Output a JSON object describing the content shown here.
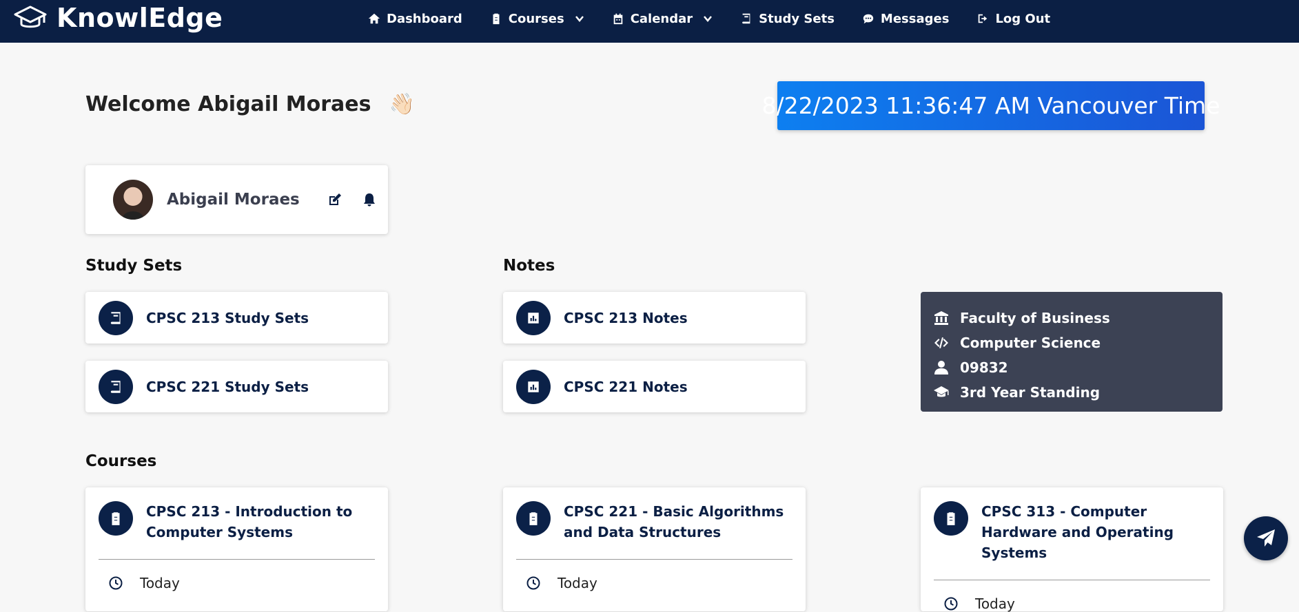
{
  "brand": {
    "name": "KnowlEdge"
  },
  "nav": {
    "dashboard": "Dashboard",
    "courses": "Courses",
    "calendar": "Calendar",
    "study_sets": "Study Sets",
    "messages": "Messages",
    "logout": "Log Out"
  },
  "welcome": {
    "text": "Welcome Abigail Moraes",
    "emoji": "👋🏻"
  },
  "clock": {
    "text": "8/22/2023 11:36:47 AM Vancouver Time"
  },
  "profile": {
    "name": "Abigail Moraes"
  },
  "study_sets": {
    "title": "Study Sets",
    "items": [
      {
        "label": "CPSC 213 Study Sets"
      },
      {
        "label": "CPSC 221 Study Sets"
      }
    ]
  },
  "notes": {
    "title": "Notes",
    "items": [
      {
        "label": "CPSC 213 Notes"
      },
      {
        "label": "CPSC 221 Notes"
      }
    ]
  },
  "info": {
    "faculty": "Faculty of Business",
    "program": "Computer Science",
    "student_id": "09832",
    "standing": "3rd Year Standing"
  },
  "courses": {
    "title": "Courses",
    "items": [
      {
        "title": "CPSC 213 - Introduction to Computer Systems",
        "when": "Today"
      },
      {
        "title": "CPSC 221 - Basic Algorithms and Data Structures",
        "when": "Today"
      },
      {
        "title": "CPSC 313 - Computer Hardware and Operating Systems",
        "when": "Today"
      }
    ]
  },
  "colors": {
    "navbar": "#0b1f44",
    "accent_blue": "#0d7ff0",
    "info_card": "#3c4254"
  }
}
